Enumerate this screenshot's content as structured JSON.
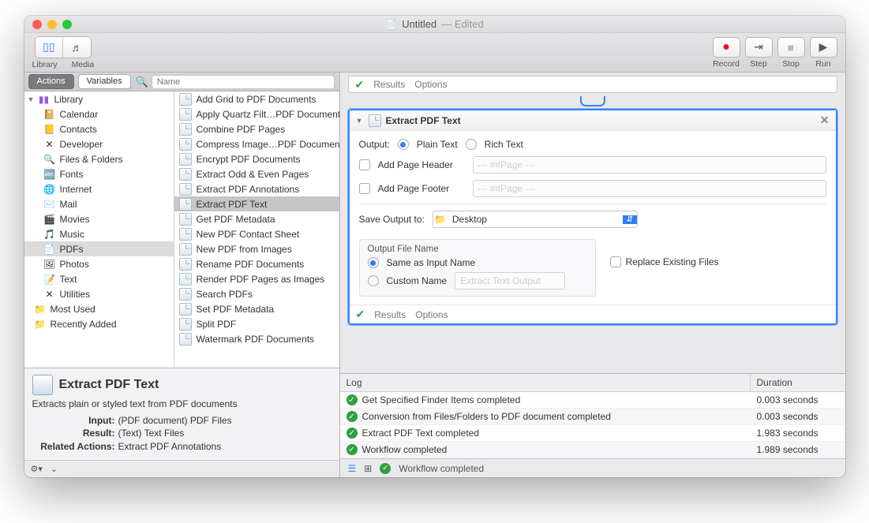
{
  "window": {
    "title": "Untitled",
    "edited": "— Edited"
  },
  "toolbar": {
    "library": "Library",
    "media": "Media",
    "record": "Record",
    "step": "Step",
    "stop": "Stop",
    "run": "Run"
  },
  "sidebar": {
    "tabs": {
      "actions": "Actions",
      "variables": "Variables"
    },
    "search_placeholder": "Name",
    "tree": {
      "root": "Library",
      "items": [
        {
          "label": "Calendar",
          "icon": "📔"
        },
        {
          "label": "Contacts",
          "icon": "📒"
        },
        {
          "label": "Developer",
          "icon": "✕"
        },
        {
          "label": "Files & Folders",
          "icon": "🔍"
        },
        {
          "label": "Fonts",
          "icon": "🔤"
        },
        {
          "label": "Internet",
          "icon": "🌐"
        },
        {
          "label": "Mail",
          "icon": "✉️"
        },
        {
          "label": "Movies",
          "icon": "🎬"
        },
        {
          "label": "Music",
          "icon": "🎵"
        },
        {
          "label": "PDFs",
          "icon": "📄",
          "selected": true
        },
        {
          "label": "Photos",
          "icon": "🖼"
        },
        {
          "label": "Text",
          "icon": "📝"
        },
        {
          "label": "Utilities",
          "icon": "✕"
        }
      ],
      "extras": [
        {
          "label": "Most Used",
          "icon": "📁",
          "color": "#7a5fdf"
        },
        {
          "label": "Recently Added",
          "icon": "📁",
          "color": "#7a5fdf"
        }
      ]
    },
    "actions": [
      "Add Grid to PDF Documents",
      "Apply Quartz Filt…PDF Documents",
      "Combine PDF Pages",
      "Compress Image…PDF Documents",
      "Encrypt PDF Documents",
      "Extract Odd & Even Pages",
      "Extract PDF Annotations",
      "Extract PDF Text",
      "Get PDF Metadata",
      "New PDF Contact Sheet",
      "New PDF from Images",
      "Rename PDF Documents",
      "Render PDF Pages as Images",
      "Search PDFs",
      "Set PDF Metadata",
      "Split PDF",
      "Watermark PDF Documents"
    ],
    "selected_action_index": 7,
    "info": {
      "title": "Extract PDF Text",
      "desc": "Extracts plain or styled text from PDF documents",
      "input_k": "Input:",
      "input_v": "(PDF document) PDF Files",
      "result_k": "Result:",
      "result_v": "(Text) Text Files",
      "related_k": "Related Actions:",
      "related_v": "Extract PDF Annotations"
    }
  },
  "prev_card": {
    "results": "Results",
    "options": "Options"
  },
  "card": {
    "title": "Extract PDF Text",
    "output_label": "Output:",
    "output_plain": "Plain Text",
    "output_rich": "Rich Text",
    "add_header": "Add Page Header",
    "add_footer": "Add Page Footer",
    "page_placeholder": "--- ##Page ---",
    "save_to_label": "Save Output to:",
    "save_to_value": "Desktop",
    "ofn_label": "Output File Name",
    "ofn_same": "Same as Input Name",
    "ofn_custom": "Custom Name",
    "ofn_custom_ph": "Extract Text Output",
    "replace_existing": "Replace Existing Files",
    "results": "Results",
    "options": "Options"
  },
  "log": {
    "head_msg": "Log",
    "head_dur": "Duration",
    "rows": [
      {
        "msg": "Get Specified Finder Items completed",
        "dur": "0.003 seconds"
      },
      {
        "msg": "Conversion from Files/Folders to PDF document completed",
        "dur": "0.003 seconds"
      },
      {
        "msg": "Extract PDF Text completed",
        "dur": "1.983 seconds"
      },
      {
        "msg": "Workflow completed",
        "dur": "1.989 seconds"
      }
    ]
  },
  "status": "Workflow completed"
}
